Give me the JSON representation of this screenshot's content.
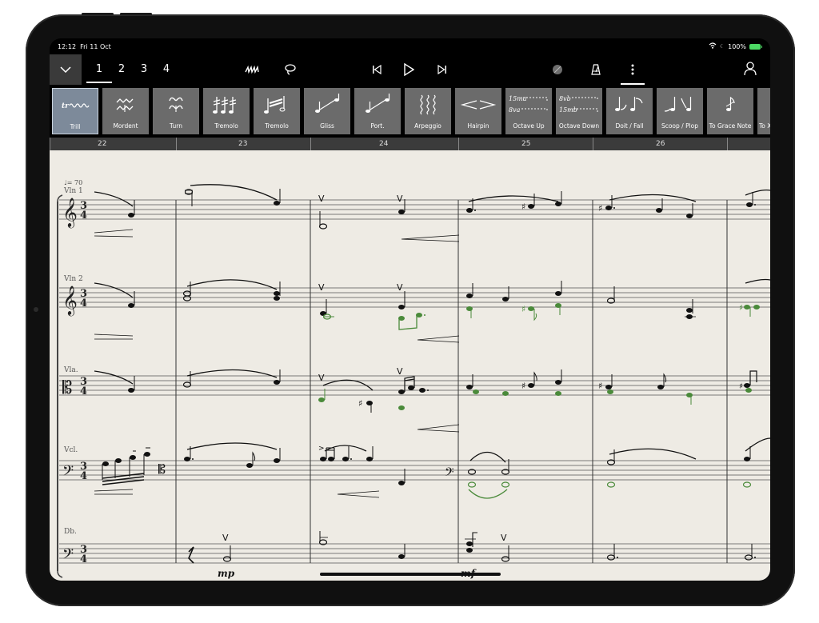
{
  "status": {
    "time": "12:12",
    "date": "Fri 11 Oct",
    "battery": "100%"
  },
  "toolbar": {
    "pages": [
      "1",
      "2",
      "3",
      "4"
    ],
    "active_page": "1"
  },
  "palette": [
    {
      "label": "Trill",
      "icon": "trill-icon",
      "selected": true
    },
    {
      "label": "Mordent",
      "icon": "mordent-icon"
    },
    {
      "label": "Turn",
      "icon": "turn-icon"
    },
    {
      "label": "Tremolo",
      "icon": "tremolo-icon"
    },
    {
      "label": "Tremolo",
      "icon": "tremolo-beam-icon"
    },
    {
      "label": "Gliss",
      "icon": "gliss-icon"
    },
    {
      "label": "Port.",
      "icon": "portamento-icon"
    },
    {
      "label": "Arpeggio",
      "icon": "arpeggio-icon"
    },
    {
      "label": "Hairpin",
      "icon": "hairpin-icon"
    },
    {
      "label": "Octave Up",
      "icon": "octave-up-icon"
    },
    {
      "label": "Octave Down",
      "icon": "octave-down-icon"
    },
    {
      "label": "Doit / Fall",
      "icon": "doit-fall-icon"
    },
    {
      "label": "Scoop / Plop",
      "icon": "scoop-plop-icon"
    },
    {
      "label": "To Grace Note",
      "icon": "grace-note-icon"
    },
    {
      "label": "To X",
      "icon": "to-x-icon"
    }
  ],
  "octave_up_text": [
    "15ma",
    "8va"
  ],
  "octave_down_text": [
    "8vb",
    "15mb"
  ],
  "ruler": {
    "bars": [
      "22",
      "23",
      "24",
      "25",
      "26"
    ]
  },
  "score": {
    "tempo": "♩= 70",
    "instruments": [
      "Vln 1",
      "Vln 2",
      "Vla.",
      "Vcl.",
      "Db."
    ],
    "time_signature": "3/4",
    "dynamics": [
      "mp",
      "mf"
    ],
    "accent_color": "#4a8a3a"
  }
}
